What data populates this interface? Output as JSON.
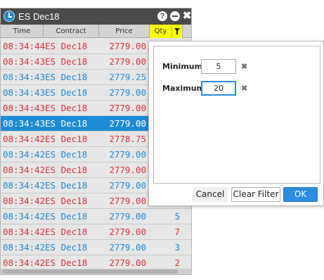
{
  "window": {
    "title": "ES Dec18"
  },
  "columns": {
    "time": "Time",
    "contract": "Contract",
    "price": "Price",
    "qty": "Qty"
  },
  "rows": [
    {
      "time": "08:34:44",
      "contract": "ES Dec18",
      "price": "2779.00",
      "qty": "",
      "color": "red"
    },
    {
      "time": "08:34:43",
      "contract": "ES Dec18",
      "price": "2779.00",
      "qty": "",
      "color": "red"
    },
    {
      "time": "08:34:43",
      "contract": "ES Dec18",
      "price": "2779.25",
      "qty": "",
      "color": "blue"
    },
    {
      "time": "08:34:43",
      "contract": "ES Dec18",
      "price": "2779.00",
      "qty": "",
      "color": "blue"
    },
    {
      "time": "08:34:43",
      "contract": "ES Dec18",
      "price": "2779.00",
      "qty": "",
      "color": "red"
    },
    {
      "time": "08:34:43",
      "contract": "ES Dec18",
      "price": "2779.00",
      "qty": "",
      "color": "selected"
    },
    {
      "time": "08:34:42",
      "contract": "ES Dec18",
      "price": "2778.75",
      "qty": "",
      "color": "red"
    },
    {
      "time": "08:34:42",
      "contract": "ES Dec18",
      "price": "2779.00",
      "qty": "",
      "color": "blue"
    },
    {
      "time": "08:34:42",
      "contract": "ES Dec18",
      "price": "2779.00",
      "qty": "",
      "color": "red"
    },
    {
      "time": "08:34:42",
      "contract": "ES Dec18",
      "price": "2779.00",
      "qty": "",
      "color": "blue"
    },
    {
      "time": "08:34:42",
      "contract": "ES Dec18",
      "price": "2779.00",
      "qty": "",
      "color": "red"
    },
    {
      "time": "08:34:42",
      "contract": "ES Dec18",
      "price": "2779.00",
      "qty": "5",
      "color": "blue"
    },
    {
      "time": "08:34:42",
      "contract": "ES Dec18",
      "price": "2779.00",
      "qty": "7",
      "color": "red"
    },
    {
      "time": "08:34:42",
      "contract": "ES Dec18",
      "price": "2779.00",
      "qty": "3",
      "color": "blue"
    },
    {
      "time": "08:34:42",
      "contract": "ES Dec18",
      "price": "2779.00",
      "qty": "2",
      "color": "red"
    }
  ],
  "filter": {
    "minimum_label": "Minimum:",
    "minimum_value": "5",
    "maximum_label": "Maximum",
    "maximum_value": "20",
    "cancel_label": "Cancel",
    "clear_label": "Clear Filter",
    "ok_label": "OK"
  },
  "colors": {
    "red": "#d9363e",
    "blue": "#1e8bd6",
    "selected_bg": "#1e8bd6",
    "filter_header": "#ffff00"
  },
  "icons": {
    "app": "clock-icon",
    "help": "help-icon",
    "minimize": "minimize-icon",
    "close": "close-icon",
    "filter": "filter-icon",
    "clear": "clear-x-icon"
  }
}
